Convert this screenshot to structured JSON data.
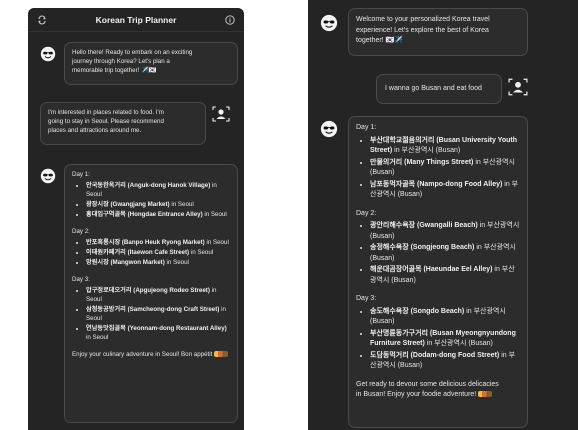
{
  "left": {
    "title": "Korean Trip Planner",
    "messages": {
      "greeting": "Hello there! Ready to embark on an exciting\njourney through Korea? Let's plan a\nmemorable trip together! ✈️🇰🇷",
      "user_request": "I'm interested in places related to food. I'm\ngoing to stay in Seoul. Please recommend\nplaces and attractions around me.",
      "itinerary": {
        "days": [
          {
            "label": "Day 1:",
            "places": [
              {
                "name": "안국동한옥거리 (Anguk-dong Hanok Village)",
                "loc": " in Seoul"
              },
              {
                "name": "광장시장 (Gwangjang Market)",
                "loc": " in Seoul"
              },
              {
                "name": "홍대입구역골목 (Hongdae Entrance Alley)",
                "loc": " in Seoul"
              }
            ]
          },
          {
            "label": "Day 2:",
            "places": [
              {
                "name": "반포흑룡시장 (Banpo Heuk Ryong Market)",
                "loc": " in Seoul"
              },
              {
                "name": "이태원카페거리 (Itaewon Cafe Street)",
                "loc": " in Seoul"
              },
              {
                "name": "망원시장 (Mangwon Market)",
                "loc": " in Seoul"
              }
            ]
          },
          {
            "label": "Day 3:",
            "places": [
              {
                "name": "압구정로데오거리 (Apgujeong Rodeo Street)",
                "loc": " in Seoul"
              },
              {
                "name": "삼청동공방거리 (Samcheong-dong Craft Street)",
                "loc": " in Seoul"
              },
              {
                "name": "연남동맛집골목 (Yeonnam-dong Restaurant Alley)",
                "loc": " in Seoul"
              }
            ]
          }
        ],
        "closing": "Enjoy your culinary adventure in Seoul! Bon appétit"
      }
    }
  },
  "right": {
    "messages": {
      "greeting": "Welcome to your personalized Korea travel\nexperience! Let's explore the best of Korea\ntogether! 🇰🇷✈️",
      "user_request": "I wanna go Busan and eat food",
      "itinerary": {
        "days": [
          {
            "label": "Day 1:",
            "places": [
              {
                "name": "부산대학교젊음의거리 (Busan University Youth Street)",
                "loc": " in 부산광역시 (Busan)"
              },
              {
                "name": "만물의거리 (Many Things Street)",
                "loc": " in 부산광역시 (Busan)"
              },
              {
                "name": "남포동먹자골목 (Nampo-dong Food Alley)",
                "loc": " in 부산광역시 (Busan)"
              }
            ]
          },
          {
            "label": "Day 2:",
            "places": [
              {
                "name": "광안리해수욕장 (Gwangalli Beach)",
                "loc": " in 부산광역시 (Busan)"
              },
              {
                "name": "송정해수욕장 (Songjeong Beach)",
                "loc": " in 부산광역시 (Busan)"
              },
              {
                "name": "해운대곰장어골목 (Haeundae Eel Alley)",
                "loc": " in 부산광역시 (Busan)"
              }
            ]
          },
          {
            "label": "Day 3:",
            "places": [
              {
                "name": "송도해수욕장 (Songdo Beach)",
                "loc": " in 부산광역시 (Busan)"
              },
              {
                "name": "부산명륜동가구거리 (Busan Myeongnyundong Furniture Street)",
                "loc": " in 부산광역시 (Busan)"
              },
              {
                "name": "도담동먹거리 (Dodam-dong Food Street)",
                "loc": " in 부산광역시 (Busan)"
              }
            ]
          }
        ],
        "closing": "Get ready to devour some delicious delicacies\nin Busan! Enjoy your foodie adventure!"
      }
    }
  },
  "colors": {
    "panel_bg": "#242424",
    "bubble_bg": "#2c2c2c",
    "bubble_border": "#4a4a4a",
    "text": "#e6e6e6"
  }
}
